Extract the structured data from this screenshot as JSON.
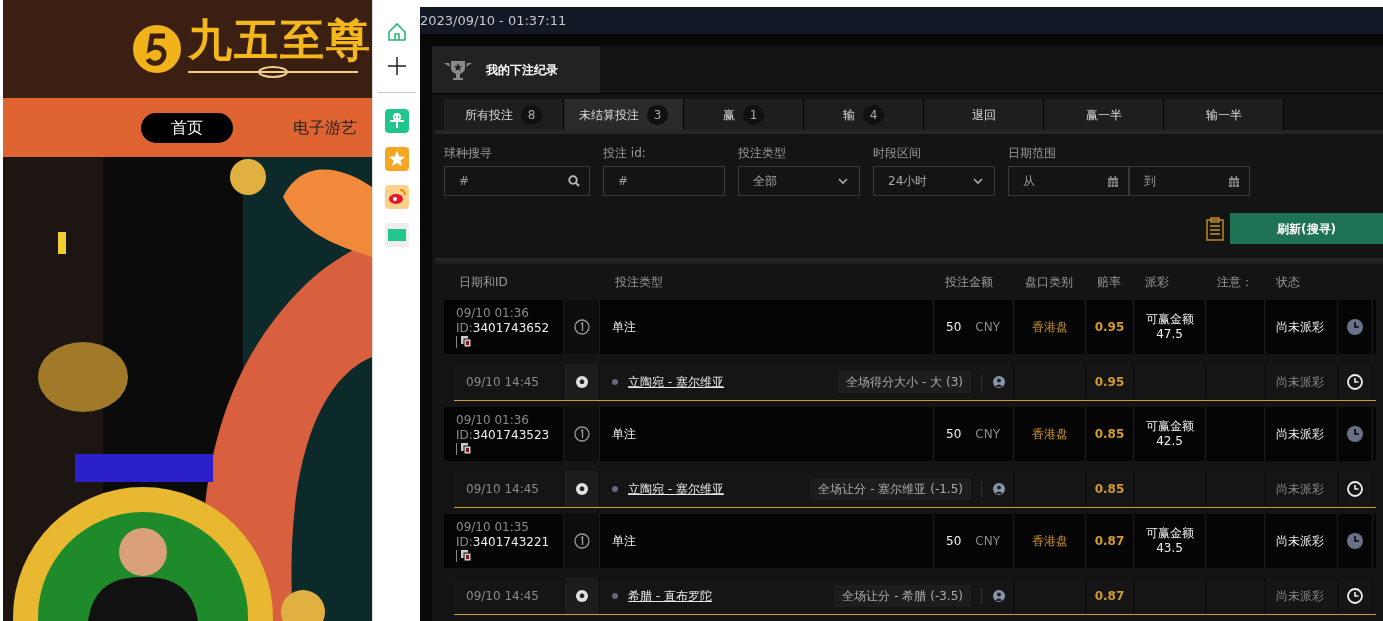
{
  "site": {
    "logo_text": "九五至尊"
  },
  "nav": [
    {
      "label": "首页",
      "selected": true
    },
    {
      "label": "电子游艺",
      "selected": false
    }
  ],
  "clock": "2023/09/10 - 01:37:11",
  "panel_title": "我的下注纪录",
  "tabs": [
    {
      "label": "所有投注",
      "count": "8",
      "selected": false
    },
    {
      "label": "未结算投注",
      "count": "3",
      "selected": true
    },
    {
      "label": "赢",
      "count": "1",
      "selected": false
    },
    {
      "label": "输",
      "count": "4",
      "selected": false
    },
    {
      "label": "退回",
      "selected": false
    },
    {
      "label": "赢一半",
      "selected": false
    },
    {
      "label": "输一半",
      "selected": false
    }
  ],
  "filters": [
    {
      "kind": "search",
      "label": "球种搜寻",
      "placeholder": "#"
    },
    {
      "kind": "text",
      "label": "投注 id:",
      "placeholder": "#"
    },
    {
      "kind": "select",
      "label": "投注类型",
      "value": "全部"
    },
    {
      "kind": "select",
      "label": "时段区间",
      "value": "24小时"
    },
    {
      "kind": "daterange",
      "label": "日期范围",
      "from_placeholder": "从",
      "to_placeholder": "到"
    }
  ],
  "refresh_button": "刷新(搜寻)",
  "table": {
    "columns": [
      "日期和ID",
      "投注类型",
      "投注金额",
      "盘口类别",
      "赔率",
      "派彩",
      "注意：",
      "状态"
    ],
    "bets": [
      {
        "date": "09/10 01:36",
        "id_label": "ID:",
        "id": "3401743652",
        "bet_type": "单注",
        "stake": "50",
        "currency": "CNY",
        "market": "香港盘",
        "odds": "0.95",
        "payout_label": "可赢金额",
        "payout": "47.5",
        "status": "尚未派彩",
        "legs": [
          {
            "date": "09/10 14:45",
            "match": "立陶宛 - 塞尔维亚",
            "selection": "全场得分大小 - 大 (3)",
            "odds": "0.95",
            "status": "尚未派彩"
          }
        ]
      },
      {
        "date": "09/10 01:36",
        "id_label": "ID:",
        "id": "3401743523",
        "bet_type": "单注",
        "stake": "50",
        "currency": "CNY",
        "market": "香港盘",
        "odds": "0.85",
        "payout_label": "可赢金额",
        "payout": "42.5",
        "status": "尚未派彩",
        "legs": [
          {
            "date": "09/10 14:45",
            "match": "立陶宛 - 塞尔维亚",
            "selection": "全场让分 - 塞尔维亚 (-1.5)",
            "odds": "0.85",
            "status": "尚未派彩"
          }
        ]
      },
      {
        "date": "09/10 01:35",
        "id_label": "ID:",
        "id": "3401743221",
        "bet_type": "单注",
        "stake": "50",
        "currency": "CNY",
        "market": "香港盘",
        "odds": "0.87",
        "payout_label": "可赢金额",
        "payout": "43.5",
        "status": "尚未派彩",
        "legs": [
          {
            "date": "09/10 14:45",
            "match": "希腊 - 直布罗陀",
            "selection": "全场让分 - 希腊 (-3.5)",
            "odds": "0.87",
            "status": "尚未派彩"
          }
        ]
      }
    ]
  }
}
